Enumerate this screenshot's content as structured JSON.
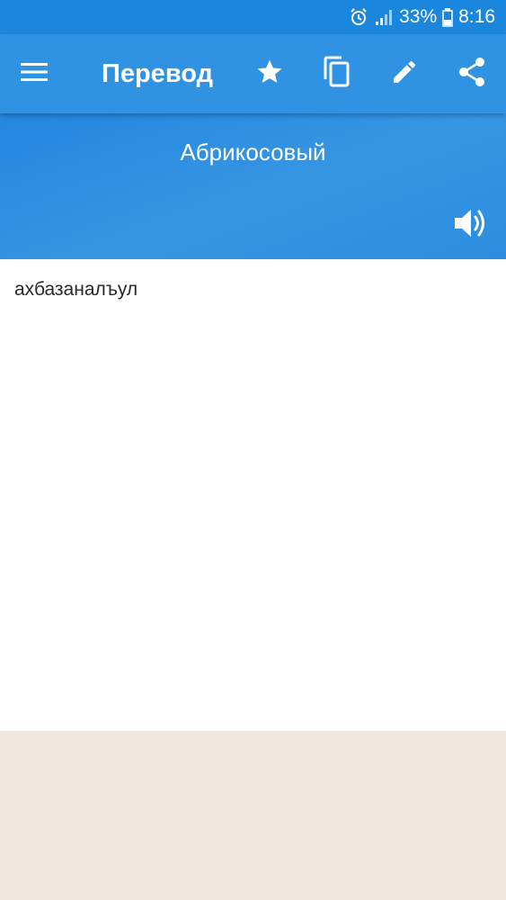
{
  "status_bar": {
    "battery_percent": "33%",
    "time": "8:16",
    "icons": [
      "alarm-icon",
      "signal-icon",
      "battery-icon"
    ]
  },
  "app_bar": {
    "title": "Перевод",
    "actions": [
      "menu-icon",
      "star-icon",
      "copy-icon",
      "edit-icon",
      "share-icon"
    ]
  },
  "header": {
    "source_word": "Абрикосовый",
    "speaker_icon": "speaker-icon"
  },
  "content": {
    "translation": "ахбазаналъул"
  },
  "colors": {
    "status_bar": "#1a86de",
    "app_bar": "#2f92e2",
    "header": "#2a8ce1",
    "content_bg": "#ffffff",
    "bottom_bg": "#f0e7df"
  }
}
